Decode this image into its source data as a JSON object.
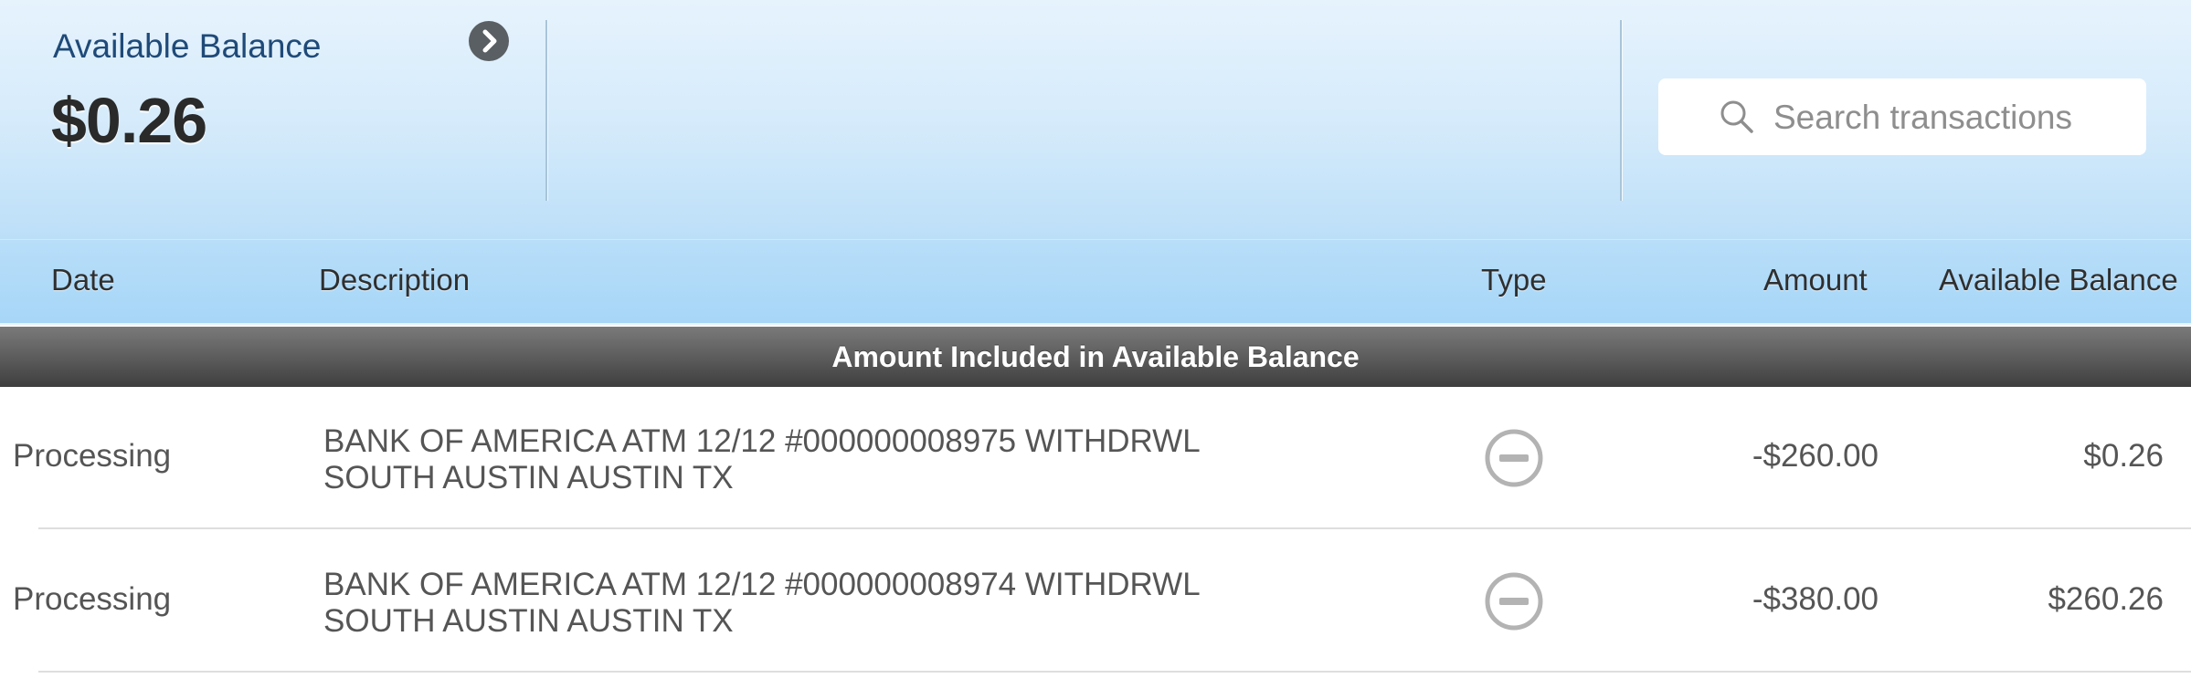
{
  "account": {
    "balance_label": "Available Balance",
    "balance_amount": "$0.26"
  },
  "search": {
    "placeholder": "Search transactions",
    "value": ""
  },
  "columns": {
    "date": "Date",
    "description": "Description",
    "type": "Type",
    "amount": "Amount",
    "available_balance": "Available Balance"
  },
  "section": {
    "title": "Amount Included in Available Balance"
  },
  "transactions": [
    {
      "date": "Processing",
      "description_line1": "BANK OF AMERICA ATM 12/12 #000000008975 WITHDRWL",
      "description_line2": "SOUTH AUSTIN AUSTIN TX",
      "type_icon": "minus-circle-icon",
      "amount": "-$260.00",
      "available_balance": "$0.26"
    },
    {
      "date": "Processing",
      "description_line1": "BANK OF AMERICA ATM 12/12 #000000008974 WITHDRWL",
      "description_line2": "SOUTH AUSTIN AUSTIN TX",
      "type_icon": "minus-circle-icon",
      "amount": "-$380.00",
      "available_balance": "$260.26"
    }
  ],
  "icons": {
    "balance_details": "chevron-right-icon",
    "search": "search-icon"
  },
  "colors": {
    "header_top": "#e6f3fd",
    "header_bottom": "#bcdff8",
    "column_bar": "#a7d6f7",
    "section_bar": "#5a5a5a",
    "label_blue": "#1f4a78",
    "row_text": "#555555",
    "type_icon": "#b3b3b3"
  }
}
